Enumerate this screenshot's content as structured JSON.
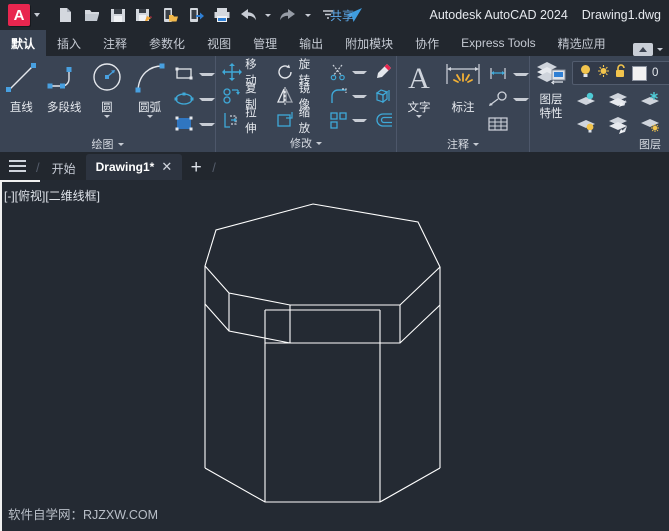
{
  "titlebar": {
    "app_badge": "A",
    "app_badge_color": "#e8264f",
    "quick_access": [
      {
        "name": "new-file-icon",
        "label": "新建"
      },
      {
        "name": "open-folder-icon",
        "label": "打开"
      },
      {
        "name": "save-icon",
        "label": "保存"
      },
      {
        "name": "save-as-icon",
        "label": "另存为"
      },
      {
        "name": "open-from-web-icon",
        "label": "从 Web 打开"
      },
      {
        "name": "save-to-web-icon",
        "label": "保存到 Web"
      },
      {
        "name": "print-icon",
        "label": "打印"
      },
      {
        "name": "undo-icon",
        "label": "放弃"
      },
      {
        "name": "redo-icon",
        "label": "重做"
      }
    ],
    "share_label": "共享",
    "app_title": "Autodesk AutoCAD 2024",
    "document_title": "Drawing1.dwg",
    "share_color": "#5da8e8"
  },
  "ribbon": {
    "tabs": [
      {
        "label": "默认",
        "active": true
      },
      {
        "label": "插入",
        "active": false
      },
      {
        "label": "注释",
        "active": false
      },
      {
        "label": "参数化",
        "active": false
      },
      {
        "label": "视图",
        "active": false
      },
      {
        "label": "管理",
        "active": false
      },
      {
        "label": "输出",
        "active": false
      },
      {
        "label": "附加模块",
        "active": false
      },
      {
        "label": "协作",
        "active": false
      },
      {
        "label": "Express Tools",
        "active": false
      },
      {
        "label": "精选应用",
        "active": false
      }
    ],
    "active_tab_bg": "#3a4454",
    "panels": [
      {
        "id": "draw",
        "title": "绘图",
        "big_buttons": [
          {
            "label": "直线",
            "icon": "line-icon",
            "has_dropdown": false
          },
          {
            "label": "多段线",
            "icon": "polyline-icon",
            "has_dropdown": false
          },
          {
            "label": "圆",
            "icon": "circle-icon",
            "has_dropdown": true
          },
          {
            "label": "圆弧",
            "icon": "arc-icon",
            "has_dropdown": true
          }
        ],
        "small_buttons": [
          {
            "label": "",
            "icon": "rectangle-icon",
            "has_dropdown": true
          },
          {
            "label": "",
            "icon": "ellipse-icon",
            "has_dropdown": true
          },
          {
            "label": "",
            "icon": "hatch-icon",
            "has_dropdown": true
          }
        ]
      },
      {
        "id": "modify",
        "title": "修改",
        "rows": [
          [
            {
              "label": "移动",
              "icon": "move-icon",
              "has_dropdown": false
            },
            {
              "label": "旋转",
              "icon": "rotate-icon",
              "has_dropdown": false
            },
            {
              "label": "",
              "icon": "trim-icon",
              "has_dropdown": true
            },
            {
              "label": "",
              "icon": "erase-icon",
              "has_dropdown": false
            }
          ],
          [
            {
              "label": "复制",
              "icon": "copy-icon",
              "has_dropdown": false
            },
            {
              "label": "镜像",
              "icon": "mirror-icon",
              "has_dropdown": false
            },
            {
              "label": "",
              "icon": "fillet-icon",
              "has_dropdown": true
            },
            {
              "label": "",
              "icon": "explode-icon",
              "has_dropdown": false
            }
          ],
          [
            {
              "label": "拉伸",
              "icon": "stretch-icon",
              "has_dropdown": false
            },
            {
              "label": "缩放",
              "icon": "scale-icon",
              "has_dropdown": false
            },
            {
              "label": "",
              "icon": "array-icon",
              "has_dropdown": true
            },
            {
              "label": "",
              "icon": "offset-icon",
              "has_dropdown": false
            }
          ]
        ]
      },
      {
        "id": "annotation",
        "title": "注释",
        "big_buttons": [
          {
            "label": "文字",
            "icon": "text-icon",
            "has_dropdown": true
          },
          {
            "label": "标注",
            "icon": "dimension-icon",
            "has_dropdown": false
          }
        ],
        "small_buttons": [
          {
            "label": "",
            "icon": "linear-dimension-icon",
            "has_dropdown": true
          },
          {
            "label": "",
            "icon": "leader-icon",
            "has_dropdown": true
          },
          {
            "label": "",
            "icon": "table-icon",
            "has_dropdown": false
          }
        ]
      },
      {
        "id": "layers",
        "title": "图层",
        "properties_label_line1": "图层",
        "properties_label_line2": "特性",
        "current_layer": "0",
        "layer_state_icons": [
          "lightbulb-on-icon",
          "sun-icon",
          "unlock-icon",
          "color-swatch-icon"
        ],
        "layer_color_swatch": "#f2f2f2",
        "grid_icons": [
          [
            "layer-isolate-icon",
            "layer-make-current-icon",
            "layer-freeze-icon",
            "layer-lock-icon"
          ],
          [
            "layer-off-icon",
            "layer-match-icon",
            "layer-thaw-icon",
            "layer-unlock-icon"
          ]
        ]
      }
    ]
  },
  "doctabs": {
    "menu_icon": "hamburger-menu-icon",
    "tabs": [
      {
        "label": "开始",
        "active": false,
        "closable": false
      },
      {
        "label": "Drawing1*",
        "active": true,
        "closable": true
      }
    ],
    "close_glyph": "✕",
    "new_tab_glyph": "+"
  },
  "canvas": {
    "viewport_label": "[-][俯视][二维线框]",
    "background": "#242a33",
    "line_color": "#ffffff",
    "watermark": "软件自学网：RJZXW.COM",
    "shape": {
      "name": "octagonal-prism-wireframe",
      "description": "3D wireframe of an octagonal prism with a top flange (chamfered lid)"
    }
  }
}
